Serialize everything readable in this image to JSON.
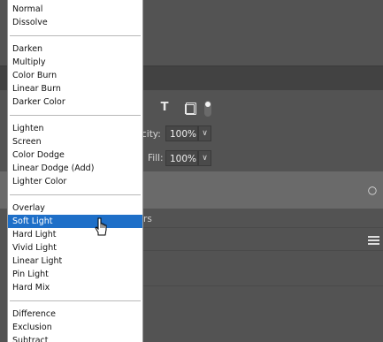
{
  "blend_mode_menu": {
    "groups": [
      [
        "Normal",
        "Dissolve"
      ],
      [
        "Darken",
        "Multiply",
        "Color Burn",
        "Linear Burn",
        "Darker Color"
      ],
      [
        "Lighten",
        "Screen",
        "Color Dodge",
        "Linear Dodge (Add)",
        "Lighter Color"
      ],
      [
        "Overlay",
        "Soft Light",
        "Hard Light",
        "Vivid Light",
        "Linear Light",
        "Pin Light",
        "Hard Mix"
      ],
      [
        "Difference",
        "Exclusion",
        "Subtract"
      ]
    ],
    "selected": "Soft Light"
  },
  "layers_panel": {
    "opacity_label": "city:",
    "opacity_value": "100%",
    "fill_label": "Fill:",
    "fill_value": "100%",
    "partial_text": "rs",
    "filter_icons": [
      "type-filter-icon",
      "shape-filter-icon",
      "smart-object-filter-icon",
      "filter-toggle-icon"
    ]
  },
  "colors": {
    "selection": "#1e6fc8",
    "panel_bg": "#535353",
    "selected_layer_bg": "#6a6a6a"
  }
}
